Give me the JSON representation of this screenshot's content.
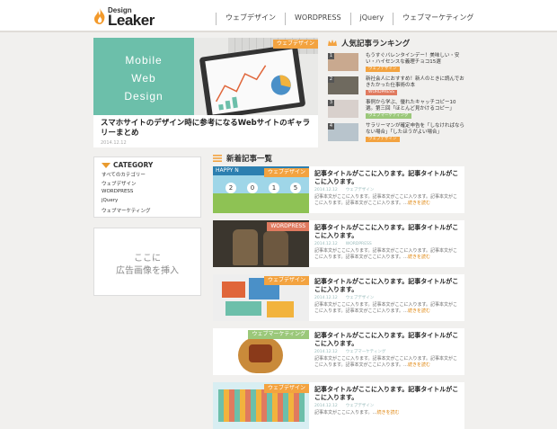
{
  "header": {
    "logo": {
      "line1": "Design",
      "line2": "Leaker"
    },
    "nav": [
      "ウェブデザイン",
      "WORDPRESS",
      "jQuery",
      "ウェブマーケティング"
    ]
  },
  "featured": {
    "image_text": [
      "Mobile",
      "Web",
      "Design"
    ],
    "category": "ウェブデザイン",
    "title": "スマホサイトのデザイン時に参考になるWebサイトのギャラリーまとめ",
    "date": "2014.12.12"
  },
  "ranking": {
    "heading": "人気記事ランキング",
    "items": [
      {
        "rank": "1",
        "title": "もうすぐバレンタインデー！美味しい・安い・ハイセンスな義理チョコ15選",
        "category": "ウェブデザイン"
      },
      {
        "rank": "2",
        "title": "新社会人におすすめ！新人のときに読んでおきたかった仕事術の本",
        "category": "WORDPRESS"
      },
      {
        "rank": "3",
        "title": "事例から学ぶ、優れたキャッチコピー10選。第三回「ほとんど見かけるコピー」",
        "category": "ウェブマーケティング"
      },
      {
        "rank": "4",
        "title": "サラリーマンが確定申告を「しなければならない場合」「したほうがよい場合」",
        "category": "ウェブデザイン"
      }
    ]
  },
  "sidebar": {
    "category_heading": "CATEGORY",
    "categories": [
      "すべてのカテゴリー",
      "ウェブデザイン",
      "WORDPRESS",
      "jQuery",
      "ウェブマーケティング"
    ],
    "ad": {
      "line1": "ここに",
      "line2": "広告画像を挿入"
    }
  },
  "new_posts": {
    "heading": "新着記事一覧",
    "items": [
      {
        "category": "ウェブデザイン",
        "title": "記事タイトルがここに入ります。記事タイトルがここに入ります。",
        "meta": "2014.12.12　　ウェブデザイン",
        "excerpt": "記事本文がここに入ります。記事本文がここに入ります。記事本文がここに入ります。記事本文がここに入ります。",
        "more": "続きを読む"
      },
      {
        "category": "WORDPRESS",
        "title": "記事タイトルがここに入ります。記事タイトルがここに入ります。",
        "meta": "2014.12.12　　WORDPRESS",
        "excerpt": "記事本文がここに入ります。記事本文がここに入ります。記事本文がここに入ります。記事本文がここに入ります。",
        "more": "続きを読む"
      },
      {
        "category": "ウェブデザイン",
        "title": "記事タイトルがここに入ります。記事タイトルがここに入ります。",
        "meta": "2014.12.12　　ウェブデザイン",
        "excerpt": "記事本文がここに入ります。記事本文がここに入ります。記事本文がここに入ります。記事本文がここに入ります。",
        "more": "続きを読む"
      },
      {
        "category": "ウェブマーケティング",
        "title": "記事タイトルがここに入ります。記事タイトルがここに入ります。",
        "meta": "2014.12.12　　ウェブマーケティング",
        "excerpt": "記事本文がここに入ります。記事本文がここに入ります。記事本文がここに入ります。記事本文がここに入ります。",
        "more": "続きを読む"
      },
      {
        "category": "ウェブデザイン",
        "title": "記事タイトルがここに入ります。記事タイトルがここに入ります。",
        "meta": "2014.12.12　　ウェブデザイン",
        "excerpt": "記事本文がここに入ります。",
        "more": "続きを読む"
      }
    ]
  },
  "colors": {
    "accent": "#f3a340",
    "wordpress": "#e07a5f",
    "marketing": "#9bc87a",
    "teal": "#6cbfaa"
  }
}
